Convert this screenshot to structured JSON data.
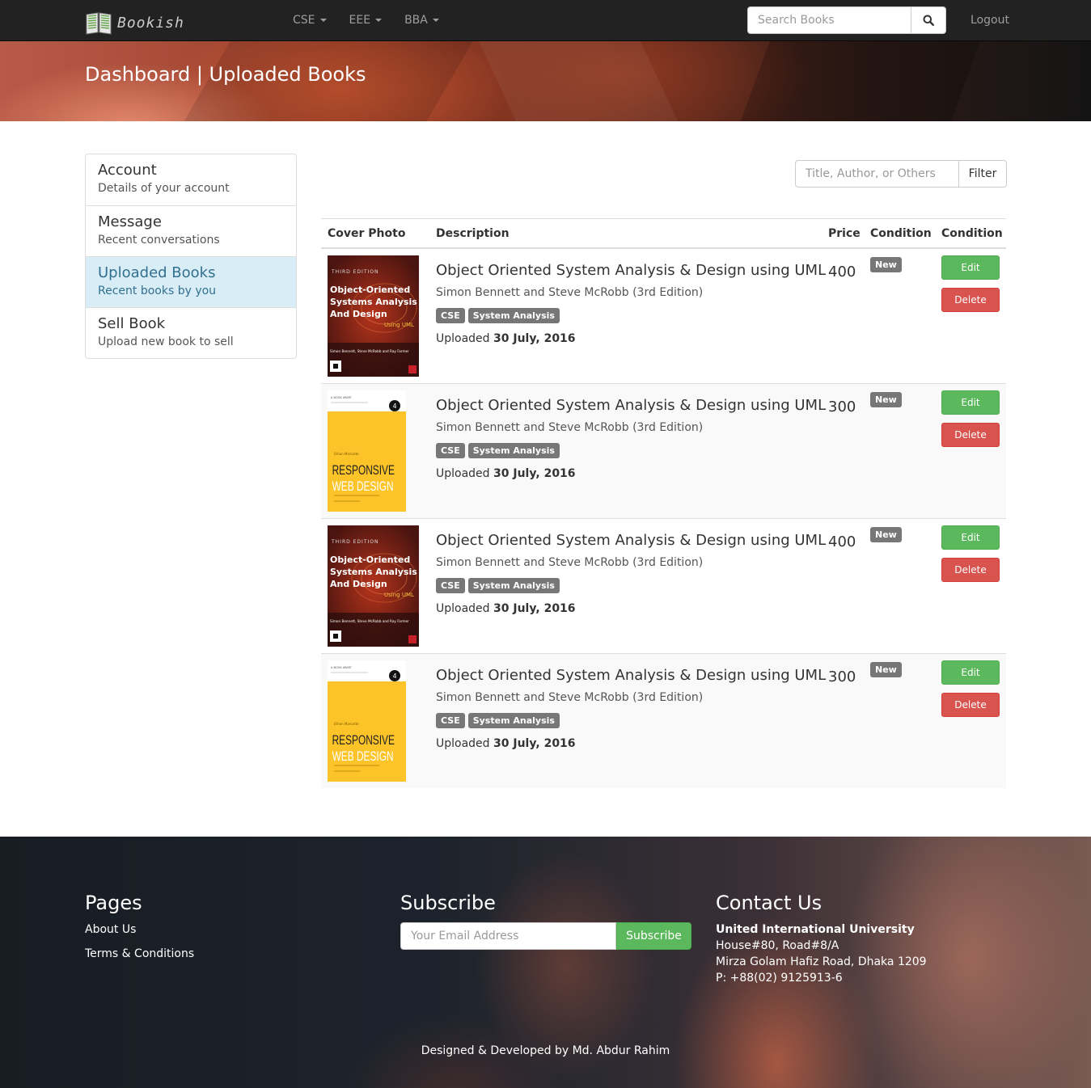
{
  "navbar": {
    "brand": "Bookish",
    "menu": [
      {
        "label": "CSE"
      },
      {
        "label": "EEE"
      },
      {
        "label": "BBA"
      }
    ],
    "search_placeholder": "Search Books",
    "logout": "Logout"
  },
  "hero": {
    "title": "Dashboard | Uploaded Books"
  },
  "sidebar": {
    "items": [
      {
        "heading": "Account",
        "subtitle": "Details of your account"
      },
      {
        "heading": "Message",
        "subtitle": "Recent conversations"
      },
      {
        "heading": "Uploaded Books",
        "subtitle": "Recent books by you"
      },
      {
        "heading": "Sell Book",
        "subtitle": "Upload new book to sell"
      }
    ],
    "active_index": 2
  },
  "filter": {
    "placeholder": "Title, Author, or Others",
    "button": "Filter"
  },
  "table": {
    "headers": [
      "Cover Photo",
      "Description",
      "Price",
      "Condition",
      "Condition"
    ],
    "rows": [
      {
        "cover": {
          "style": "red",
          "edition": "THIRD EDITION",
          "title": [
            "Object-Oriented",
            "Systems Analysis",
            "And Design"
          ],
          "subtitle": "Using UML",
          "authors": "Simon Bennett, Steve McRobb and Ray Farmer"
        },
        "title": "Object Oriented System Analysis & Design using UML",
        "authors": "Simon Bennett and Steve McRobb (3rd Edition)",
        "tags": [
          "CSE",
          "System Analysis"
        ],
        "uploaded_prefix": "Uploaded",
        "uploaded_date": "30 July, 2016",
        "price": "400",
        "condition": "New",
        "edit": "Edit",
        "delete": "Delete"
      },
      {
        "cover": {
          "style": "yellow",
          "badge": "4",
          "title": [
            "RESPONSIVE",
            "WEB DESIGN"
          ],
          "author": "Ethan Marcotte"
        },
        "title": "Object Oriented System Analysis & Design using UML",
        "authors": "Simon Bennett and Steve McRobb (3rd Edition)",
        "tags": [
          "CSE",
          "System Analysis"
        ],
        "uploaded_prefix": "Uploaded",
        "uploaded_date": "30 July, 2016",
        "price": "300",
        "condition": "New",
        "edit": "Edit",
        "delete": "Delete"
      },
      {
        "cover": {
          "style": "red",
          "edition": "THIRD EDITION",
          "title": [
            "Object-Oriented",
            "Systems Analysis",
            "And Design"
          ],
          "subtitle": "Using UML",
          "authors": "Simon Bennett, Steve McRobb and Ray Farmer"
        },
        "title": "Object Oriented System Analysis & Design using UML",
        "authors": "Simon Bennett and Steve McRobb (3rd Edition)",
        "tags": [
          "CSE",
          "System Analysis"
        ],
        "uploaded_prefix": "Uploaded",
        "uploaded_date": "30 July, 2016",
        "price": "400",
        "condition": "New",
        "edit": "Edit",
        "delete": "Delete"
      },
      {
        "cover": {
          "style": "yellow",
          "badge": "4",
          "title": [
            "RESPONSIVE",
            "WEB DESIGN"
          ],
          "author": "Ethan Marcotte"
        },
        "title": "Object Oriented System Analysis & Design using UML",
        "authors": "Simon Bennett and Steve McRobb (3rd Edition)",
        "tags": [
          "CSE",
          "System Analysis"
        ],
        "uploaded_prefix": "Uploaded",
        "uploaded_date": "30 July, 2016",
        "price": "300",
        "condition": "New",
        "edit": "Edit",
        "delete": "Delete"
      }
    ]
  },
  "footer": {
    "pages": {
      "heading": "Pages",
      "links": [
        "About Us",
        "Terms & Conditions"
      ]
    },
    "subscribe": {
      "heading": "Subscribe",
      "placeholder": "Your Email Address",
      "button": "Subscribe"
    },
    "contact": {
      "heading": "Contact Us",
      "org": "United International University",
      "lines": [
        "House#80, Road#8/A",
        "Mirza Golam Hafiz Road, Dhaka 1209",
        "P: +88(02) 9125913-6"
      ]
    },
    "credit": "Designed & Developed by Md. Abdur Rahim"
  },
  "colors": {
    "navbar_bg": "#222222",
    "active_item_bg": "#d9edf7",
    "active_item_text": "#31708f",
    "label_gray": "#777777",
    "success": "#5cb85c",
    "danger": "#d9534f"
  },
  "icons": {
    "brand": "book-logo-icon",
    "search": "search-icon",
    "dropdown": "caret-down-icon"
  }
}
